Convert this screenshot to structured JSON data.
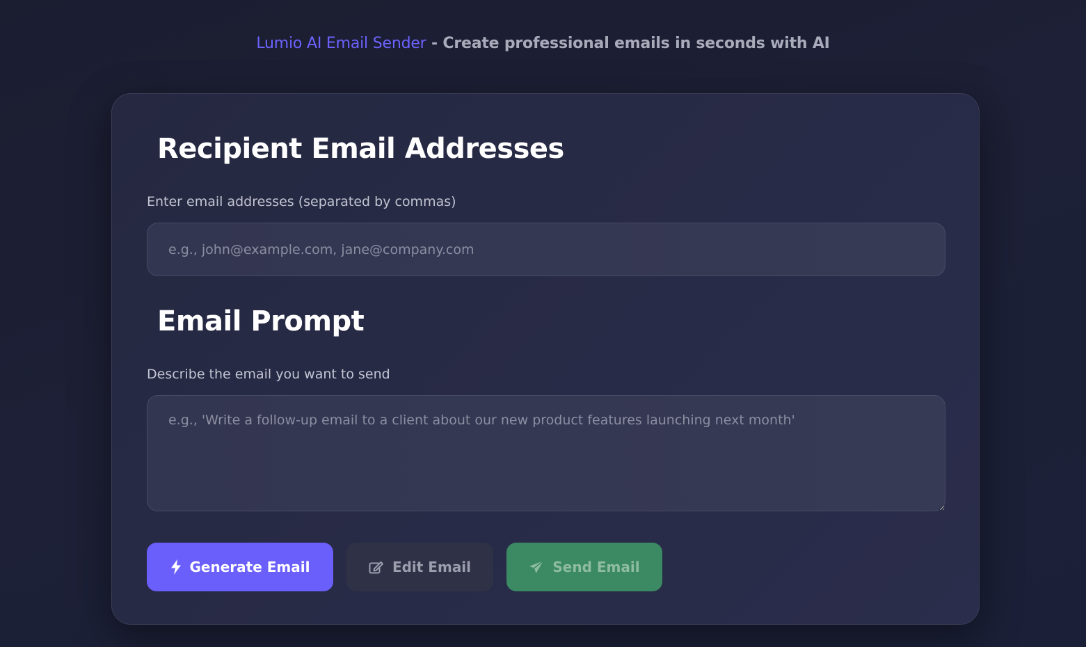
{
  "header": {
    "brand": "Lumio AI Email Sender",
    "tagline": " - Create professional emails in seconds with AI"
  },
  "recipients": {
    "title": "Recipient Email Addresses",
    "label": "Enter email addresses (separated by commas)",
    "placeholder": "e.g., john@example.com, jane@company.com",
    "value": ""
  },
  "prompt": {
    "title": "Email Prompt",
    "label": "Describe the email you want to send",
    "placeholder": "e.g., 'Write a follow-up email to a client about our new product features launching next month'",
    "value": ""
  },
  "actions": {
    "generate_label": "Generate Email",
    "generate_icon": "bolt-icon",
    "edit_label": "Edit Email",
    "edit_icon": "edit-icon",
    "send_label": "Send Email",
    "send_icon": "paper-plane-icon"
  },
  "colors": {
    "brand": "#6d63ff",
    "primary_button": "#6b5ffc",
    "send_button": "#3b8a63",
    "background": "#1c1f35"
  }
}
